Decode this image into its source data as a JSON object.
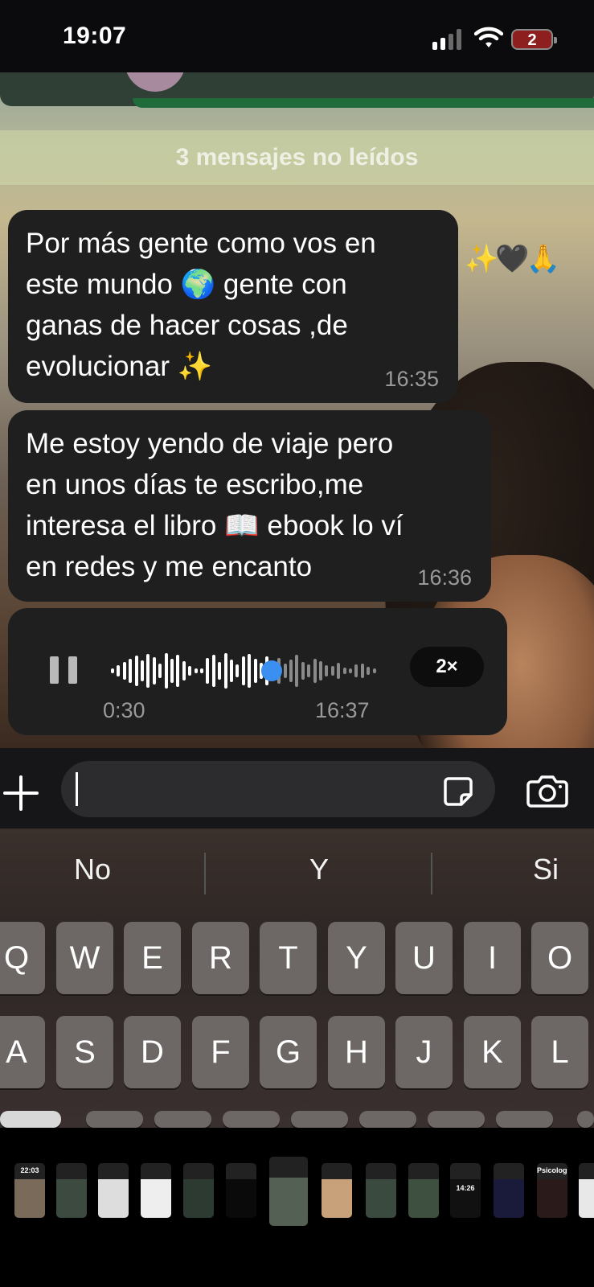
{
  "status_bar": {
    "time": "19:07",
    "battery_level": "2",
    "signal_bars": 2,
    "icons": [
      "signal-icon",
      "wifi-icon",
      "battery-icon"
    ]
  },
  "chat": {
    "unread_banner": "3 mensajes no leídos",
    "messages": [
      {
        "lines": [
          "Por más gente como vos en",
          "este mundo 🌍 gente con",
          "ganas de hacer cosas ,de",
          "evolucionar ✨"
        ],
        "time": "16:35",
        "reaction": "✨🖤🙏"
      },
      {
        "lines": [
          "Me estoy yendo de viaje pero",
          "en unos días te escribo,me",
          "interesa el libro 📖 ebook lo ví",
          "en redes y me encanto"
        ],
        "time": "16:36"
      }
    ],
    "voice_note": {
      "duration": "0:30",
      "time": "16:37",
      "speed": "2×",
      "progress": 0.6,
      "played_color": "#ffffff",
      "unplayed_color": "#8a8a8a",
      "accent": "#3b8ff0"
    }
  },
  "composer": {
    "value": "",
    "placeholder": "",
    "icons": [
      "plus-icon",
      "sticker-icon",
      "camera-icon"
    ]
  },
  "keyboard": {
    "suggestions": [
      "No",
      "Y",
      "Si"
    ],
    "row1": [
      "Q",
      "W",
      "E",
      "R",
      "T",
      "Y",
      "U",
      "I",
      "O"
    ],
    "row2": [
      "A",
      "S",
      "D",
      "F",
      "G",
      "H",
      "J",
      "K",
      "L"
    ]
  },
  "thumbnails": {
    "labels": [
      "22:03",
      "14:26",
      "Psicología"
    ]
  }
}
